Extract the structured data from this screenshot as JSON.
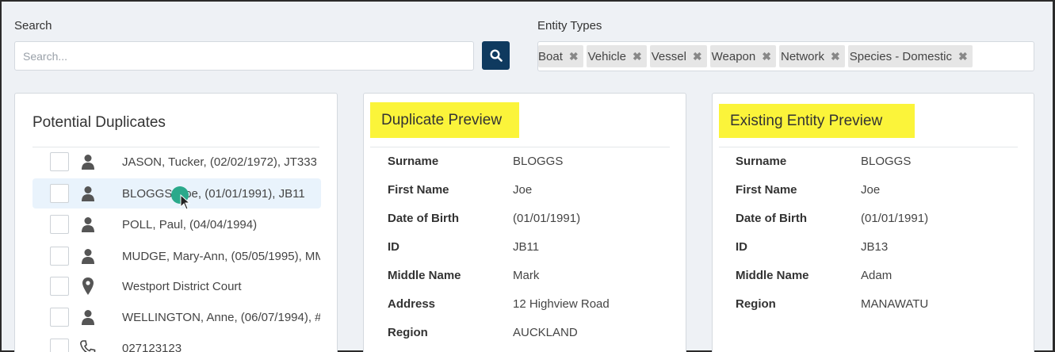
{
  "search": {
    "label": "Search",
    "placeholder": "Search..."
  },
  "entity_types": {
    "label": "Entity Types",
    "tags": [
      "Boat",
      "Vehicle",
      "Vessel",
      "Weapon",
      "Network",
      "Species - Domestic"
    ]
  },
  "duplicates": {
    "title": "Potential Duplicates",
    "items": [
      {
        "icon": "person-icon",
        "text": "JASON, Tucker, (02/02/1972), JT333"
      },
      {
        "icon": "person-icon",
        "text": "BLOGGS, Joe, (01/01/1991), JB11"
      },
      {
        "icon": "person-icon",
        "text": "POLL, Paul, (04/04/1994)"
      },
      {
        "icon": "person-icon",
        "text": "MUDGE, Mary-Ann, (05/05/1995), MM"
      },
      {
        "icon": "location-pin-icon",
        "text": "Westport District Court"
      },
      {
        "icon": "person-icon",
        "text": "WELLINGTON, Anne, (06/07/1994), #"
      },
      {
        "icon": "phone-icon",
        "text": "027123123"
      }
    ]
  },
  "duplicate_preview": {
    "title": "Duplicate Preview",
    "fields": [
      {
        "label": "Surname",
        "value": "BLOGGS"
      },
      {
        "label": "First Name",
        "value": "Joe"
      },
      {
        "label": "Date of Birth",
        "value": "(01/01/1991)"
      },
      {
        "label": "ID",
        "value": "JB11"
      },
      {
        "label": "Middle Name",
        "value": "Mark"
      },
      {
        "label": "Address",
        "value": "12 Highview Road"
      },
      {
        "label": "Region",
        "value": "AUCKLAND"
      }
    ]
  },
  "existing_preview": {
    "title": "Existing Entity Preview",
    "fields": [
      {
        "label": "Surname",
        "value": "BLOGGS"
      },
      {
        "label": "First Name",
        "value": "Joe"
      },
      {
        "label": "Date of Birth",
        "value": "(01/01/1991)"
      },
      {
        "label": "ID",
        "value": "JB13"
      },
      {
        "label": "Middle Name",
        "value": "Adam"
      },
      {
        "label": "Region",
        "value": "MANAWATU"
      }
    ]
  },
  "colors": {
    "accent": "#0f3a5f",
    "highlight": "#fbf43a",
    "selected_row": "#e9f3fc",
    "cursor_dot": "#2aa98b"
  }
}
